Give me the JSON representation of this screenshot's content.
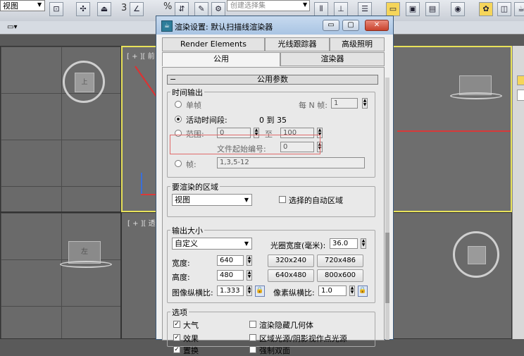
{
  "app": {
    "view_combo": "视图",
    "selection_set_placeholder": "创建选择集",
    "toolbar_number_a": "3",
    "toolbar_number_b": "%"
  },
  "viewports": {
    "top_right_label": "[ + ][ 前",
    "top_left_label": "[ + ][",
    "bottom_right_label": "[ + ][ 透",
    "cube_top": "上",
    "cube_bottom": "左"
  },
  "dialog": {
    "title": "渲染设置: 默认扫描线渲染器",
    "tabs_row1": [
      "Render Elements",
      "光线跟踪器",
      "高级照明"
    ],
    "tabs_row2": [
      "公用",
      "渲染器"
    ],
    "rollout_title": "公用参数",
    "time_output": {
      "group_label": "时间输出",
      "single": "单帧",
      "every_n_label": "每 N 帧:",
      "every_n_value": "1",
      "active_segment": "活动时间段:",
      "active_range": "0 到 35",
      "range": "范围:",
      "range_from": "0",
      "range_to_label": "至",
      "range_to": "100",
      "file_start_label": "文件起始编号:",
      "file_start": "0",
      "frames": "帧:",
      "frames_value": "1,3,5-12"
    },
    "render_area": {
      "group_label": "要渲染的区域",
      "area_combo": "视图",
      "auto_region": "选择的自动区域"
    },
    "output_size": {
      "group_label": "输出大小",
      "preset_combo": "自定义",
      "aperture_label": "光圈宽度(毫米):",
      "aperture_value": "36.0",
      "width_label": "宽度:",
      "width_value": "640",
      "height_label": "高度:",
      "height_value": "480",
      "presets": [
        "320x240",
        "720x486",
        "640x480",
        "800x600"
      ],
      "image_aspect_label": "图像纵横比:",
      "image_aspect_value": "1.333",
      "pixel_aspect_label": "像素纵横比:",
      "pixel_aspect_value": "1.0"
    },
    "options": {
      "group_label": "选项",
      "left": [
        "大气",
        "效果",
        "置换"
      ],
      "right": [
        "渲染隐藏几何体",
        "区域光源/阴影视作点光源",
        "强制双面"
      ]
    }
  },
  "colors": {
    "highlight": "#e06a6a",
    "arrow": "#e03030",
    "viewport_active": "#e8e25a"
  }
}
